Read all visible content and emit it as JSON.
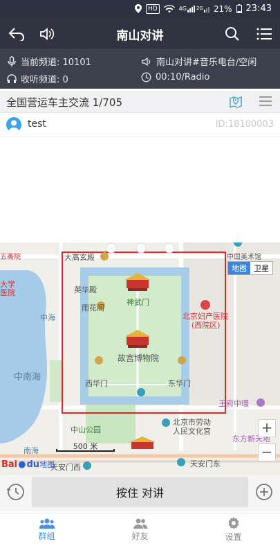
{
  "status_bar": {
    "badge_hd": "HD",
    "network": "4G",
    "network2": "2G",
    "battery": "21%",
    "time": "23:43"
  },
  "header": {
    "title": "南山对讲"
  },
  "channel_info": {
    "current_channel": "当前频道: 10101",
    "listen_channel": "收听频道: 0",
    "station": "南山对讲#音乐电台/空闲",
    "radio": "00:10/Radio"
  },
  "group_bar": {
    "name": "全国营运车主交流 1/705"
  },
  "member": {
    "name": "test",
    "id": "ID:18100003"
  },
  "map": {
    "toggle": {
      "map_label": "地图",
      "satellite_label": "卫星"
    },
    "labels": {
      "dagao": "大高玄殿",
      "art": "中国美术馆",
      "univ1": "大学",
      "univ2": "医院",
      "wuzhai": "五斋院",
      "yinghua": "英华殿",
      "yuhuage": "雨花阁",
      "shenwu": "神武门",
      "maternity1": "北京妇产医院",
      "maternity2": "(西院区)",
      "zhonghai": "中海",
      "zhongnanhai": "中南海",
      "palace": "故宫博物院",
      "xihua": "西华门",
      "donghua": "东华门",
      "wangfu": "王府中環",
      "laodong1": "北京市劳动",
      "laodong2": "人民文化宫",
      "zhongshan": "中山公园",
      "dongfang": "东方新天地",
      "nanhai": "南海",
      "tiananmen_w": "天安门西",
      "tiananmen_e": "天安门东"
    },
    "scale": "500 米",
    "logo_text": "Bai",
    "logo_paw": "du",
    "logo_map": "地图",
    "zoom_in": "+",
    "zoom_out": "−"
  },
  "ptt": {
    "label": "按住 对讲"
  },
  "nav": {
    "items": [
      {
        "label": "群组",
        "active": true
      },
      {
        "label": "好友",
        "active": false
      },
      {
        "label": "设置",
        "active": false
      }
    ]
  },
  "colors": {
    "header_bg": "#2f3440",
    "info_bg": "#3b404c",
    "accent": "#4a93d8",
    "highlight_box": "#e0272a",
    "palace_wall": "#a7cde8",
    "palace_grass": "#c8e6c0",
    "water": "#a6cbe8"
  }
}
